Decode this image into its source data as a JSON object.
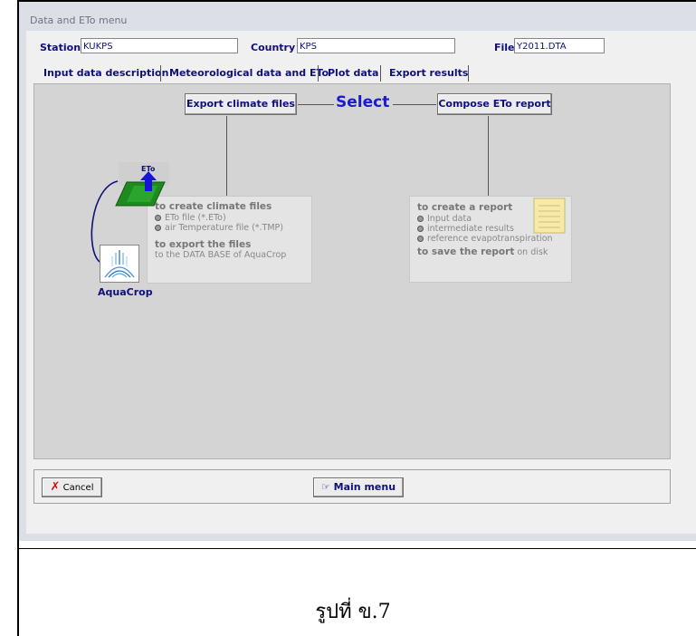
{
  "window": {
    "title": "Data and ETo menu"
  },
  "header": {
    "station_label": "Station",
    "station_value": "KUKPS",
    "country_label": "Country",
    "country_value": "KPS",
    "file_label": "File",
    "file_value": "Y2011.DTA"
  },
  "tabs": [
    {
      "label": "Input data description"
    },
    {
      "label": "Meteorological data and ETo"
    },
    {
      "label": "Plot data"
    },
    {
      "label": "Export results"
    }
  ],
  "panel": {
    "export_button": "Export climate files",
    "select_label": "Select",
    "compose_button": "Compose ETo report",
    "climate_box": {
      "heading1": "to create climate files",
      "items": [
        "ETo file (*.ETo)",
        "air Temperature file (*.TMP)"
      ],
      "heading2": "to export the files",
      "line2": "to the DATA BASE of AquaCrop"
    },
    "report_box": {
      "heading1": "to create a report",
      "items": [
        "Input data",
        "intermediate results",
        "reference evapotranspiration"
      ],
      "heading2": "to save the report",
      "line2_suffix": "on disk"
    },
    "eto_icon_label": "ETo",
    "aquacrop_label": "AquaCrop"
  },
  "footer": {
    "cancel_label": "Cancel",
    "main_menu_label": "Main menu"
  },
  "caption": "รูปที่ ข.7",
  "colors": {
    "label_text": "#10107a",
    "select_text": "#1c1ccc",
    "panel_bg": "#d4d4d4"
  }
}
